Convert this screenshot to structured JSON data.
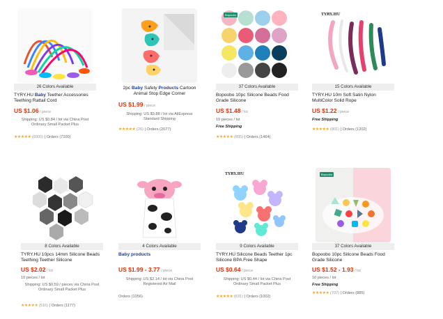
{
  "products": [
    {
      "colors": "26 Colors Available",
      "title_pre": "TYRY.HU ",
      "title_bold": "Baby",
      "title_post": " Teether Accessories Teething Rattail Cord",
      "price": "US $1.06",
      "price_unit": " / piece",
      "line1": "Shipping: US $0.84 / lot via China Post Ordinary Small Packet Plus",
      "stars": "★★★★★",
      "rating": "(6000)",
      "orders": "Orders (7100)"
    },
    {
      "colors": "",
      "title_pre": "2pc ",
      "title_bold": "Baby",
      "title_mid": " Safety ",
      "title_bold2": "Products",
      "title_post": " Cartoon Animal Stop Edge Corner",
      "price": "US $1.99",
      "price_unit": " / piece",
      "line1": "Shipping: US $3.88 / lot via AliExpress Standard Shipping",
      "stars": "★★★★★",
      "rating": "(26)",
      "orders": "Orders (2077)"
    },
    {
      "colors": "37 Colors Available",
      "title": "Bopoobo 10pc Silicone Beads Food Grade Silicone",
      "price": "US $1.48",
      "price_unit": " / lot",
      "line1": "10 pieces / lot",
      "free": "Free Shipping",
      "stars": "★★★★★",
      "rating": "(855)",
      "orders": "Orders (1464)",
      "logo": "Bopoobo"
    },
    {
      "colors": "15 Colors Available",
      "title": "TYRY.HU 10m Soft Satin Nylon MultiColor Solid Rope",
      "price": "US $1.22",
      "price_unit": " / piece",
      "free": "Free Shipping",
      "stars": "★★★★★",
      "rating": "(801)",
      "orders": "Orders (1202)",
      "logo": "TYRY.HU"
    },
    {
      "colors": "8 Colors Available",
      "title": "TYRY.HU 10pcs 14mm Silicone Beads Teething Teether Silicone",
      "price": "US $2.02",
      "price_unit": " / lot",
      "line0": "10 pieces / lot",
      "line1": "Shipping: US $0.59 / pieces via China Post Ordinary Small Packet Plus",
      "stars": "★★★★★",
      "rating": "(516)",
      "orders": "Orders (1177)"
    },
    {
      "colors": "4 Colors Available",
      "title_bold": "Baby products",
      "price": "US $1.99 - 3.77",
      "price_unit": " / piece",
      "line1": "Shipping: US $2.14 / lot via China Post Registered Air Mail",
      "orders": "Orders (1056)"
    },
    {
      "colors": "9 Colors Available",
      "title": "TYRY.HU Silicone Beads Teether 1pc Silicone BPA Free Shape",
      "price": "US $0.64",
      "price_unit": " / piece",
      "line1": "Shipping: US $0.44 / lot via China Post Ordinary Small Packet Plus",
      "stars": "★★★★★",
      "rating": "(631)",
      "orders": "Orders (1002)",
      "logo": "TYRY.HU"
    },
    {
      "colors": "37 Colors Available",
      "title": "Bopoobo 10pc Silicone Beads Food Grade Silicone",
      "price": "US $1.52 - 1.93",
      "price_unit": " / lot",
      "line0": "10 pieces / lot",
      "free": "Free Shipping",
      "stars": "★★★★★",
      "rating": "(707)",
      "orders": "Orders (885)",
      "logo": "Bopoobo"
    }
  ],
  "theme": {
    "price_color": "#e62e04",
    "link_color": "#1a3ea8",
    "star_color": "#f6a623",
    "colors_bar": "#eeeeee"
  }
}
